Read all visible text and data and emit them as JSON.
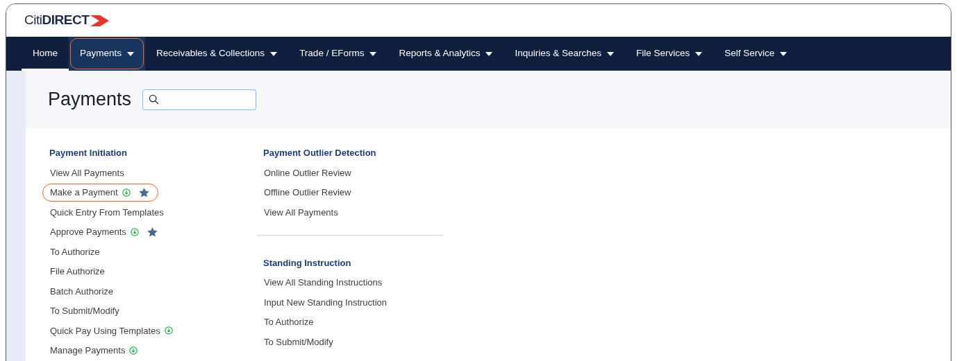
{
  "logo": {
    "text": "Citi**DIRECT**"
  },
  "nav": [
    {
      "label": "Home",
      "selected": true,
      "dropdown": false,
      "highlighted": false
    },
    {
      "label": "Payments",
      "selected": false,
      "dropdown": true,
      "highlighted": true
    },
    {
      "label": "Receivables & Collections",
      "selected": false,
      "dropdown": true,
      "highlighted": false
    },
    {
      "label": "Trade / EForms",
      "selected": false,
      "dropdown": true,
      "highlighted": false
    },
    {
      "label": "Reports & Analytics",
      "selected": false,
      "dropdown": true,
      "highlighted": false
    },
    {
      "label": "Inquiries & Searches",
      "selected": false,
      "dropdown": true,
      "highlighted": false
    },
    {
      "label": "File Services",
      "selected": false,
      "dropdown": true,
      "highlighted": false
    },
    {
      "label": "Self Service",
      "selected": false,
      "dropdown": true,
      "highlighted": false
    }
  ],
  "page": {
    "title": "Payments"
  },
  "columns": [
    [
      {
        "heading": "Payment Initiation",
        "items": [
          {
            "label": "View All Payments",
            "info": false,
            "starred": false,
            "highlighted": false
          },
          {
            "label": "Make a Payment",
            "info": true,
            "starred": true,
            "highlighted": true
          },
          {
            "label": "Quick Entry From Templates",
            "info": false,
            "starred": false,
            "highlighted": false
          },
          {
            "label": "Approve Payments",
            "info": true,
            "starred": true,
            "highlighted": false
          },
          {
            "label": "To Authorize",
            "info": false,
            "starred": false,
            "highlighted": false
          },
          {
            "label": "File Authorize",
            "info": false,
            "starred": false,
            "highlighted": false
          },
          {
            "label": "Batch Authorize",
            "info": false,
            "starred": false,
            "highlighted": false
          },
          {
            "label": "To Submit/Modify",
            "info": false,
            "starred": false,
            "highlighted": false
          },
          {
            "label": "Quick Pay Using Templates",
            "info": true,
            "starred": false,
            "highlighted": false
          },
          {
            "label": "Manage Payments",
            "info": true,
            "starred": false,
            "highlighted": false
          }
        ]
      }
    ],
    [
      {
        "heading": "Payment Outlier Detection",
        "items": [
          {
            "label": "Online Outlier Review",
            "info": false,
            "starred": false,
            "highlighted": false
          },
          {
            "label": "Offline Outlier Review",
            "info": false,
            "starred": false,
            "highlighted": false
          },
          {
            "label": "View All Payments",
            "info": false,
            "starred": false,
            "highlighted": false
          }
        ]
      },
      {
        "heading": "Standing Instruction",
        "items": [
          {
            "label": "View All Standing Instructions",
            "info": false,
            "starred": false,
            "highlighted": false
          },
          {
            "label": "Input New Standing Instruction",
            "info": false,
            "starred": false,
            "highlighted": false
          },
          {
            "label": "To Authorize",
            "info": false,
            "starred": false,
            "highlighted": false
          },
          {
            "label": "To Submit/Modify",
            "info": false,
            "starred": false,
            "highlighted": false
          }
        ]
      }
    ]
  ]
}
